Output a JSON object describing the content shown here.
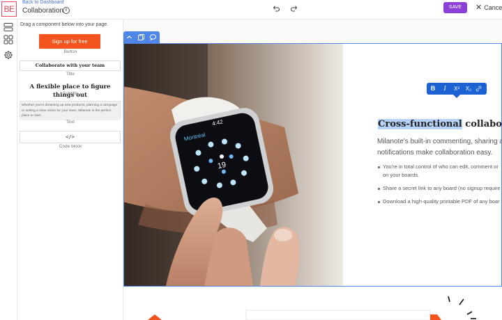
{
  "topbar": {
    "logo_text": "BE",
    "back_link": "Back to Dashboard",
    "page_name": "Collaboration",
    "save_label": "SAVE",
    "cancel_label": "Cancel",
    "icons": [
      "info-icon",
      "undo-icon",
      "redo-icon",
      "close-icon"
    ]
  },
  "rail": {
    "icons": [
      "layout-icon",
      "components-icon",
      "settings-icon"
    ]
  },
  "panel": {
    "hint": "Drag a component below into your page.",
    "components": [
      {
        "preview": "Sign up for free",
        "label": "Button"
      },
      {
        "preview": "Collaborate with your team",
        "label": "Title"
      },
      {
        "preview": "A flexible place to figure things out",
        "label": "Subtitle"
      },
      {
        "preview": "Whether you're dreaming up new products, planning a campaign or setting a clear vision for your team, Milanote is the perfect place to start.",
        "label": "Text"
      },
      {
        "preview": "</>",
        "label": "Code block"
      }
    ]
  },
  "block_tools": {
    "icons": [
      "chevron-up-icon",
      "duplicate-icon",
      "comment-icon"
    ]
  },
  "format_toolbar": {
    "bold": "B",
    "italic": "I",
    "superscript": "X²",
    "subscript": "X₂",
    "icons": [
      "link-icon"
    ]
  },
  "section": {
    "watch": {
      "city": "Montréal",
      "time": "4:42",
      "number": "19"
    },
    "headline_highlighted": "Cross-functional",
    "headline_rest": " collaboratio",
    "body_line1": "Milanote's built-in commenting, sharing an",
    "body_line2": "notifications make collaboration easy.",
    "bullets": [
      "You're in total control of who can edit, comment or",
      "on your boards.",
      "Share a secret link to any board (no signup require",
      "Download a high-quality printable PDF of any boar"
    ]
  },
  "colors": {
    "accent_purple": "#8c3fd8",
    "cta_orange": "#f4541e",
    "selection_blue": "#4f86e8",
    "toolbar_blue": "#1c62d2",
    "highlight": "#b6d3fb"
  }
}
